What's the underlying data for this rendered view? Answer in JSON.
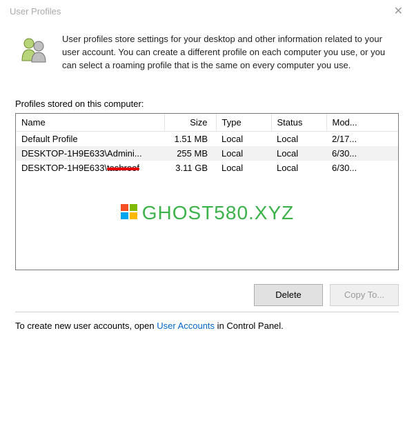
{
  "window": {
    "title": "User Profiles"
  },
  "description": "User profiles store settings for your desktop and other information related to your user account. You can create a different profile on each computer you use, or you can select a roaming profile that is the same on every computer you use.",
  "section_label": "Profiles stored on this computer:",
  "columns": {
    "name": "Name",
    "size": "Size",
    "type": "Type",
    "status": "Status",
    "modified": "Mod..."
  },
  "rows": [
    {
      "name": "Default Profile",
      "size": "1.51 MB",
      "type": "Local",
      "status": "Local",
      "modified": "2/17...",
      "selected": false,
      "redacted": false
    },
    {
      "name": "DESKTOP-1H9E633\\Admini...",
      "size": "255 MB",
      "type": "Local",
      "status": "Local",
      "modified": "6/30...",
      "selected": true,
      "redacted": false
    },
    {
      "name_prefix": "DESKTOP-1H9E633\\",
      "name_redacted": "tashroof",
      "size": "3.11 GB",
      "type": "Local",
      "status": "Local",
      "modified": "6/30...",
      "selected": false,
      "redacted": true
    }
  ],
  "watermark": "GHOST580.XYZ",
  "buttons": {
    "delete": "Delete",
    "copy_to": "Copy To..."
  },
  "footer": {
    "prefix": "To create new user accounts, open ",
    "link": "User Accounts",
    "suffix": " in Control Panel."
  }
}
